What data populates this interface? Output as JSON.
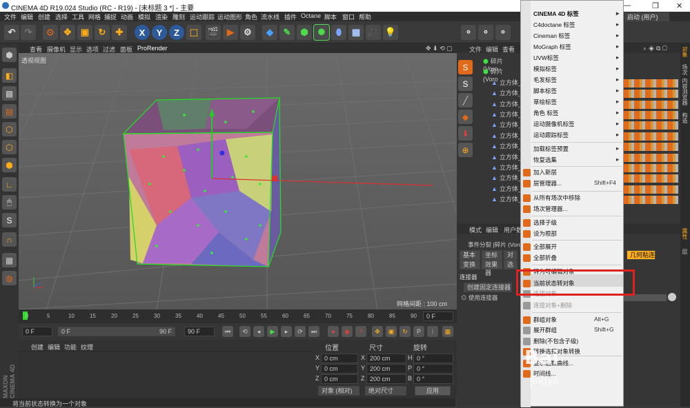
{
  "titlebar": {
    "title": "CINEMA 4D R19.024 Studio (RC - R19) - [未标题 3 *] - 主要"
  },
  "menubar": [
    "文件",
    "编辑",
    "创建",
    "选择",
    "工具",
    "网格",
    "捕捉",
    "动画",
    "模拟",
    "渲染",
    "雕刻",
    "运动跟踪",
    "运动图形",
    "角色",
    "流水线",
    "插件",
    "Octane",
    "脚本",
    "窗口",
    "帮助"
  ],
  "layout_label": "启动 (用户)",
  "viewport": {
    "menu": [
      "查看",
      "摄像机",
      "显示",
      "选项",
      "过滤",
      "面板",
      "ProRender"
    ],
    "label": "透视视图",
    "grid_info": "网格间距 : 100 cm"
  },
  "timeline": {
    "ticks": [
      "0",
      "5",
      "10",
      "15",
      "20",
      "25",
      "30",
      "35",
      "40",
      "45",
      "50",
      "55",
      "60",
      "65",
      "70",
      "75",
      "80",
      "85",
      "90"
    ],
    "current_frame": "0 F"
  },
  "transport": {
    "start": "0 F",
    "min": "0 F",
    "max": "90 F",
    "end": "90 F"
  },
  "material_panel": {
    "tabs": [
      "创建",
      "编辑",
      "功能",
      "纹理"
    ]
  },
  "coord_panel": {
    "headers": [
      "位置",
      "尺寸",
      "旋转"
    ],
    "rows": [
      {
        "axis": "X",
        "pos": "0 cm",
        "size_axis": "X",
        "size": "200 cm",
        "rot_axis": "H",
        "rot": "0 °"
      },
      {
        "axis": "Y",
        "pos": "0 cm",
        "size_axis": "Y",
        "size": "200 cm",
        "rot_axis": "P",
        "rot": "0 °"
      },
      {
        "axis": "Z",
        "pos": "0 cm",
        "size_axis": "Z",
        "size": "200 cm",
        "rot_axis": "B",
        "rot": "0 °"
      }
    ],
    "mode_select": "对象 (相对)",
    "size_select": "绝对尺寸",
    "apply_label": "应用"
  },
  "statusbar": "将当前状态转换为一个对象",
  "object_manager": {
    "menu": [
      "文件",
      "编辑",
      "查看"
    ],
    "rows": [
      "碎片 (Voro",
      "碎片 (Voro",
      "立方体_fr",
      "立方体_fr",
      "立方体_fr",
      "立方体_fr",
      "立方体_fr",
      "立方体_fr",
      "立方体_fr",
      "立方体_fr",
      "立方体_fr",
      "立方体_fr",
      "立方体_fr",
      "立方体_fr"
    ]
  },
  "attribute_manager": {
    "menu": [
      "模式",
      "编辑",
      "用户数"
    ],
    "object_name": "事件分裂 [碎片 (Voro",
    "tabs": [
      "基本",
      "坐标",
      "对"
    ],
    "tabs2": [
      "变换",
      "效果器",
      "选"
    ],
    "geometry_button": "几何粘连",
    "section": "连接器",
    "create_connector": "创建固定连接器",
    "use_connector": "使用连接器"
  },
  "side_tabs": [
    "对象",
    "场次",
    "内容浏览器",
    "构造",
    "属性",
    "层"
  ],
  "context_menu": {
    "items": [
      {
        "label": "CINEMA 4D 标签",
        "arrow": "▸",
        "bold": true
      },
      {
        "label": "C4doctane 标签",
        "arrow": "▸"
      },
      {
        "label": "Cineman 标签",
        "arrow": "▸"
      },
      {
        "label": "MoGraph 标签",
        "arrow": "▸"
      },
      {
        "label": "UVW标签",
        "arrow": "▸"
      },
      {
        "label": "模拟标签",
        "arrow": "▸"
      },
      {
        "label": "毛发标签",
        "arrow": "▸"
      },
      {
        "label": "脚本标签",
        "arrow": "▸"
      },
      {
        "label": "草绘标签",
        "arrow": "▸"
      },
      {
        "label": "角色 标签",
        "arrow": "▸"
      },
      {
        "label": "运动摄像机标签",
        "arrow": "▸"
      },
      {
        "label": "运动跟踪标签",
        "arrow": "▸"
      },
      {
        "label": "加载标签预置",
        "arrow": "▸"
      },
      {
        "label": "恢复选集",
        "arrow": "▸"
      },
      {
        "label": "加入新层"
      },
      {
        "label": "层管理器...",
        "shortcut": "Shift+F4"
      },
      {
        "label": "从所有场次中移除"
      },
      {
        "label": "场次管理器..."
      },
      {
        "label": "选择子级"
      },
      {
        "label": "设为根部"
      },
      {
        "label": "全部展开"
      },
      {
        "label": "全部折叠"
      },
      {
        "label": "转为可编辑对象"
      },
      {
        "label": "当前状态转对象"
      },
      {
        "label": "连接对象"
      },
      {
        "label": "连接对象+删除"
      },
      {
        "label": "群组对象",
        "shortcut": "Alt+G"
      },
      {
        "label": "展开群组",
        "shortcut": "Shift+G"
      },
      {
        "label": "删除(不包含子级)"
      },
      {
        "label": "转换选择对象转换"
      },
      {
        "label": "显示函数曲线..."
      },
      {
        "label": "时间线..."
      }
    ],
    "colors": {
      "menu_bg": "#f0f0f0",
      "highlight": "#d8d8d8",
      "callout": "#e01f1f"
    }
  },
  "watermark": {
    "line1": "Bai",
    "line2": "jingya"
  },
  "colors": {
    "accent": "#ffae1a",
    "orange": "#e06a1a",
    "selection_green": "#22dd22",
    "panel": "#363636",
    "viewport": "#5f5f5f"
  }
}
